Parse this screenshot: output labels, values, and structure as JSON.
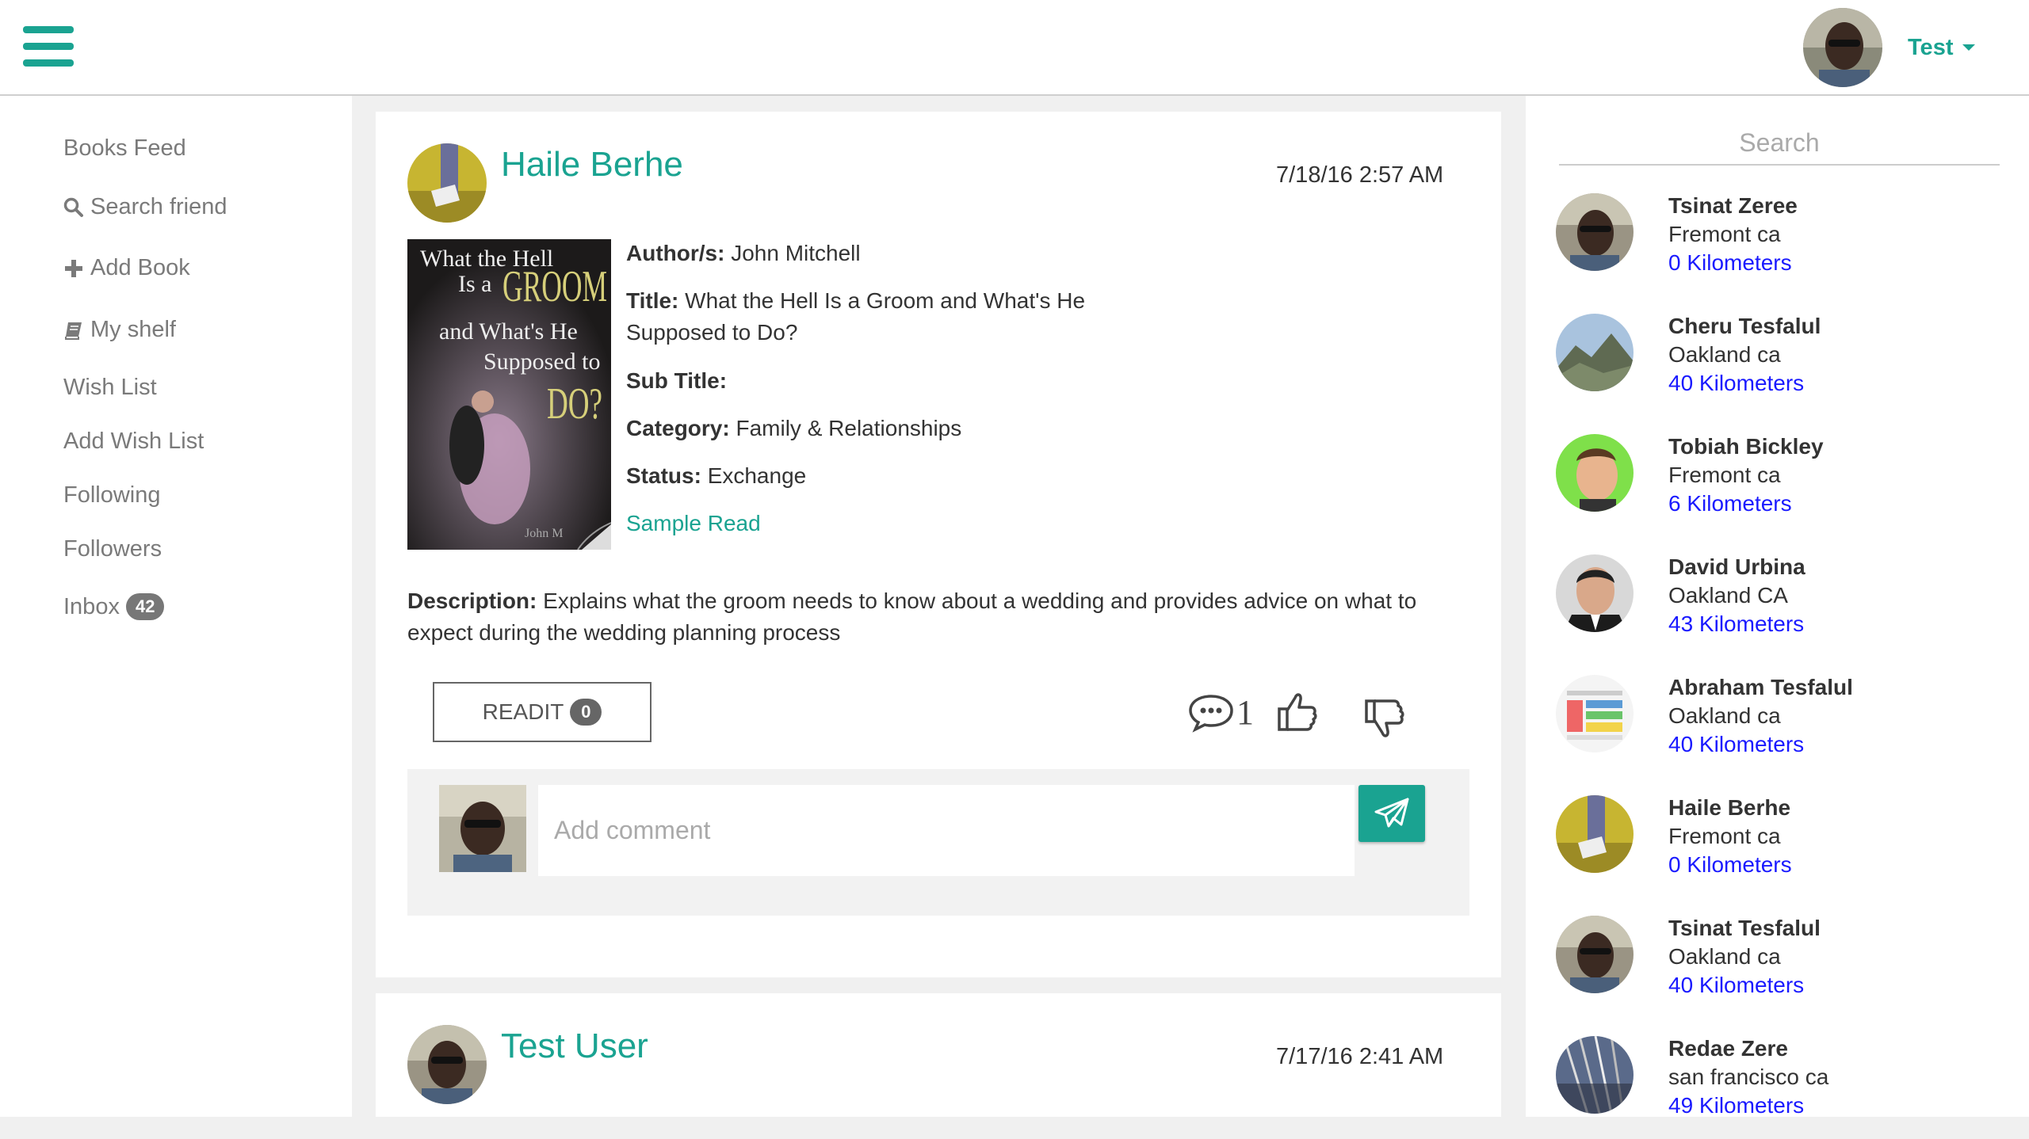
{
  "header": {
    "menu_icon": "hamburger-menu-icon",
    "user_name": "Test"
  },
  "sidebar": {
    "items": [
      {
        "label": "Books Feed",
        "icon": ""
      },
      {
        "label": "Search friend",
        "icon": "search-icon"
      },
      {
        "label": "Add Book",
        "icon": "plus-icon"
      },
      {
        "label": "My shelf",
        "icon": "book-icon"
      },
      {
        "label": "Wish List",
        "icon": ""
      },
      {
        "label": "Add Wish List",
        "icon": ""
      },
      {
        "label": "Following",
        "icon": ""
      },
      {
        "label": "Followers",
        "icon": ""
      },
      {
        "label": "Inbox",
        "icon": "",
        "badge": "42"
      }
    ]
  },
  "feed": {
    "posts": [
      {
        "author": "Haile Berhe",
        "time": "7/18/16 2:57 AM",
        "cover": {
          "line1": "What the Hell",
          "line2": "Is a",
          "line3": "GROOM",
          "line4": "and What's He",
          "line5": "Supposed to",
          "line6": "DO?",
          "line7": "John M"
        },
        "authors_label": "Author/s:",
        "authors": "John Mitchell",
        "title_label": "Title:",
        "title_line1": "What the Hell Is a Groom and What's He",
        "title_line2": "Supposed to Do?",
        "subtitle_label": "Sub Title:",
        "subtitle": "",
        "category_label": "Category:",
        "category": "Family & Relationships",
        "status_label": "Status:",
        "status": "Exchange",
        "sample_read": "Sample Read",
        "description_label": "Description:",
        "description": "Explains what the groom needs to know about a wedding and provides advice on what to expect during the wedding planning process",
        "readit_label": "READIT",
        "readit_count": "0",
        "comment_count": "1",
        "comment_placeholder": "Add comment"
      },
      {
        "author": "Test User",
        "time": "7/17/16 2:41 AM"
      }
    ]
  },
  "right_panel": {
    "search_placeholder": "Search",
    "friends": [
      {
        "name": "Tsinat Zeree",
        "location": "Fremont ca",
        "distance": "0 Kilometers"
      },
      {
        "name": "Cheru Tesfalul",
        "location": "Oakland ca",
        "distance": "40 Kilometers"
      },
      {
        "name": "Tobiah Bickley",
        "location": "Fremont ca",
        "distance": "6 Kilometers"
      },
      {
        "name": "David Urbina",
        "location": "Oakland CA",
        "distance": "43 Kilometers"
      },
      {
        "name": "Abraham Tesfalul",
        "location": "Oakland ca",
        "distance": "40 Kilometers"
      },
      {
        "name": "Haile Berhe",
        "location": "Fremont ca",
        "distance": "0 Kilometers"
      },
      {
        "name": "Tsinat Tesfalul",
        "location": "Oakland ca",
        "distance": "40 Kilometers"
      },
      {
        "name": "Redae Zere",
        "location": "san francisco ca",
        "distance": "49 Kilometers"
      }
    ]
  },
  "colors": {
    "accent": "#1aa391",
    "link_blue": "#1a1aff",
    "badge_grey": "#777777"
  }
}
